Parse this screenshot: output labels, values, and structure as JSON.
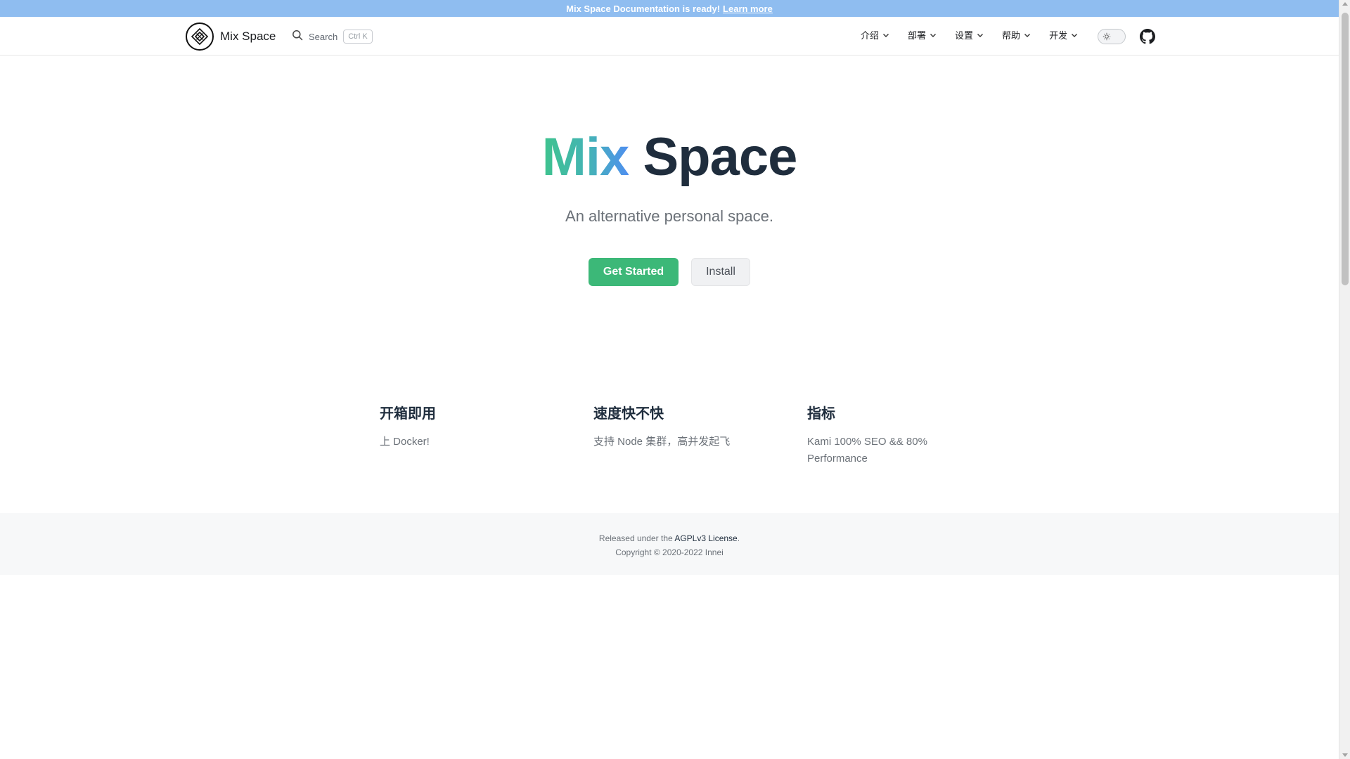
{
  "announcement": {
    "text": "Mix Space Documentation is ready!",
    "link_label": "Learn more"
  },
  "navbar": {
    "brand": "Mix Space",
    "search": {
      "label": "Search",
      "shortcut": "Ctrl K"
    },
    "items": [
      {
        "label": "介绍"
      },
      {
        "label": "部署"
      },
      {
        "label": "设置"
      },
      {
        "label": "帮助"
      },
      {
        "label": "开发"
      }
    ],
    "icons": {
      "logo": "diamond-logo-icon",
      "search": "search-icon",
      "chevron": "chevron-down-icon",
      "theme": "sun-icon",
      "github": "github-icon"
    }
  },
  "hero": {
    "title_part1": "Mix",
    "title_part2": "Space",
    "tagline": "An alternative personal space.",
    "primary_button": "Get Started",
    "secondary_button": "Install"
  },
  "features": [
    {
      "title": "开箱即用",
      "description": "上 Docker!"
    },
    {
      "title": "速度快不快",
      "description": "支持 Node 集群，高并发起飞"
    },
    {
      "title": "指标",
      "description": "Kami 100% SEO && 80% Performance"
    }
  ],
  "footer": {
    "license_prefix": "Released under the",
    "license_link": "AGPLv3 License",
    "license_suffix": ".",
    "copyright": "Copyright © 2020-2022 Innei"
  },
  "colors": {
    "announcement_bg": "#8fbdf0",
    "primary": "#3cb878",
    "gradient_start": "#3ec38d",
    "gradient_end": "#4f8ff0",
    "heading": "#1f2d3d"
  }
}
